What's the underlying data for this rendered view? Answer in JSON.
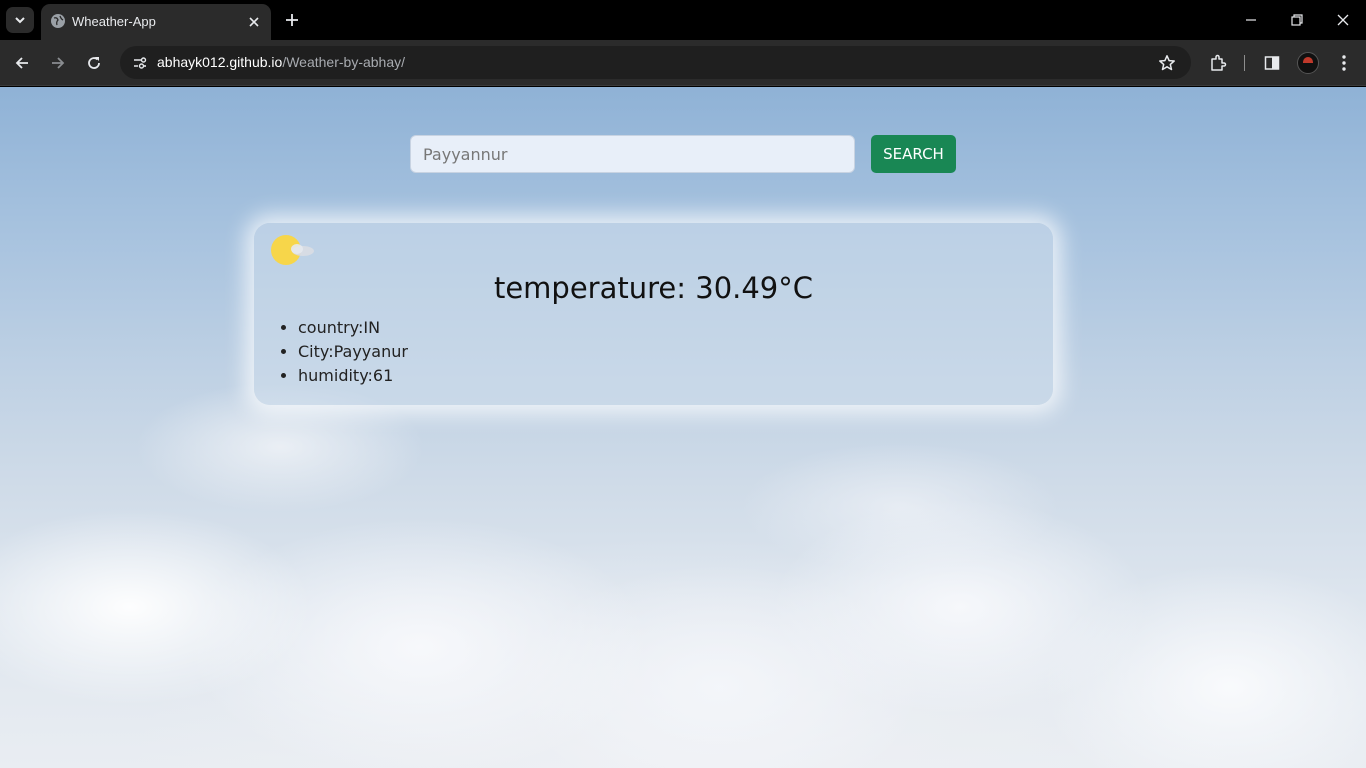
{
  "browser": {
    "tab_title": "Wheather-App",
    "url_host": "abhayk012.github.io",
    "url_path": "/Weather-by-abhay/",
    "icons": [
      "tab-search-icon",
      "globe-icon",
      "close-icon",
      "plus-icon",
      "minimize-icon",
      "restore-icon",
      "close-window-icon",
      "back-icon",
      "forward-icon",
      "reload-icon",
      "site-info-icon",
      "star-icon",
      "extensions-icon",
      "side-panel-icon",
      "more-icon"
    ]
  },
  "search": {
    "placeholder": "Payyannur",
    "button_label": "SEARCH"
  },
  "weather": {
    "icon": "sun-cloud-icon",
    "temperature_text": "temperature: 30.49°C",
    "details": [
      "country:IN",
      "City:Payyanur",
      "humidity:61"
    ]
  },
  "colors": {
    "search_button": "#198754",
    "sun": "#f7d64a"
  }
}
